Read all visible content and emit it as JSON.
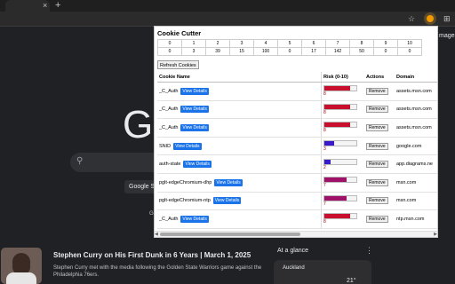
{
  "browser": {
    "new_tab_symbol": "+",
    "tab_close_symbol": "×",
    "apps_label": "mages"
  },
  "google": {
    "logo_fragment": "G",
    "search_button_fragment": "Google Se",
    "below_fragment": "Go"
  },
  "popup": {
    "title": "Cookie Cutter",
    "risk_buckets": [
      "0",
      "1",
      "2",
      "3",
      "4",
      "5",
      "6",
      "7",
      "8",
      "9",
      "10"
    ],
    "risk_counts": [
      "0",
      "3",
      "39",
      "15",
      "100",
      "0",
      "17",
      "142",
      "50",
      "0",
      "0"
    ],
    "refresh_label": "Refresh Cookies",
    "headers": {
      "name": "Cookie Name",
      "risk": "Risk (0-10)",
      "actions": "Actions",
      "domain": "Domain"
    },
    "view_label": "View Details",
    "remove_label": "Remove",
    "rows": [
      {
        "name": "_C_Auth",
        "risk": 8,
        "riskText": "8",
        "color": "#c8102e",
        "domain": "assets.msn.com"
      },
      {
        "name": "_C_Auth",
        "risk": 8,
        "riskText": "8",
        "color": "#c8102e",
        "domain": "assets.msn.com"
      },
      {
        "name": "_C_Auth",
        "risk": 8,
        "riskText": "8",
        "color": "#c8102e",
        "domain": "assets.msn.com"
      },
      {
        "name": "SNID",
        "risk": 3,
        "riskText": "3",
        "color": "#3a1acb",
        "domain": "google.com"
      },
      {
        "name": "auth-state",
        "risk": 2,
        "riskText": "2",
        "color": "#3a1acb",
        "domain": "app.diagrams.ne"
      },
      {
        "name": "pglt-edgeChromium-dhp",
        "risk": 7,
        "riskText": "7",
        "color": "#a0126a",
        "domain": "msn.com"
      },
      {
        "name": "pglt-edgeChromium-ntp",
        "risk": 7,
        "riskText": "7",
        "color": "#a0126a",
        "domain": "msn.com"
      },
      {
        "name": "_C_Auth",
        "risk": 8,
        "riskText": "8",
        "color": "#c8102e",
        "domain": "ntp.msn.com"
      }
    ]
  },
  "feed": {
    "news_title": "Stephen Curry on His First Dunk in 6 Years | March 1, 2025",
    "news_sub": "Stephen Curry met with the media following the Golden State Warriors game against the Philadelphia 76ers.",
    "glance_title": "At a glance",
    "glance_more": "⋮",
    "weather_city": "Auckland",
    "weather_temp": "21°"
  }
}
